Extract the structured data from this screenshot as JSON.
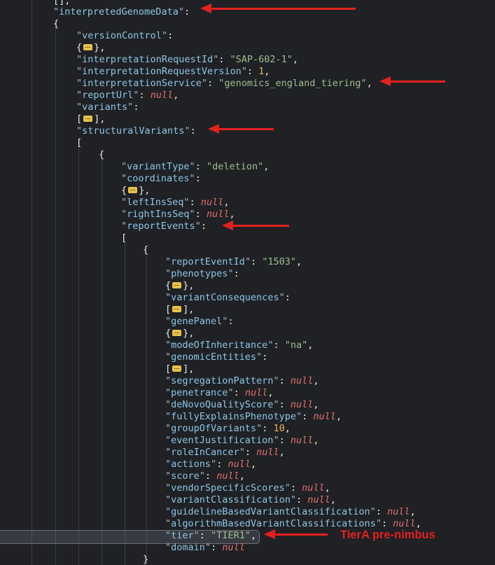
{
  "punct": {
    "q": "\"",
    "colon": ": ",
    "comma": ",",
    "open_brace": "{",
    "close_brace": "}",
    "open_bracket": "[",
    "close_bracket": "]",
    "top_fragment": "[],"
  },
  "json": {
    "interpreted_genome_data_key": "interpretedGenomeData",
    "version_control_key": "versionControl",
    "interpretation_request_id_key": "interpretationRequestId",
    "interpretation_request_id_value": "\"SAP-602-1\"",
    "interpretation_request_version_key": "interpretationRequestVersion",
    "interpretation_request_version_value": "1",
    "interpretation_service_key": "interpretationService",
    "interpretation_service_value": "\"genomics_england_tiering\"",
    "report_url_key": "reportUrl",
    "null_value": "null",
    "variants_key": "variants",
    "structural_variants_key": "structuralVariants",
    "variant_type_key": "variantType",
    "variant_type_value": "\"deletion\"",
    "coordinates_key": "coordinates",
    "left_ins_seq_key": "leftInsSeq",
    "right_ins_seq_key": "rightInsSeq",
    "report_events_key": "reportEvents",
    "report_event_id_key": "reportEventId",
    "report_event_id_value": "\"1503\"",
    "phenotypes_key": "phenotypes",
    "variant_consequences_key": "variantConsequences",
    "gene_panel_key": "genePanel",
    "mode_of_inheritance_key": "modeOfInheritance",
    "mode_of_inheritance_value": "\"na\"",
    "genomic_entities_key": "genomicEntities",
    "segregation_pattern_key": "segregationPattern",
    "penetrance_key": "penetrance",
    "de_novo_quality_score_key": "deNovoQualityScore",
    "fully_explains_phenotype_key": "fullyExplainsPhenotype",
    "group_of_variants_key": "groupOfVariants",
    "group_of_variants_value": "10",
    "event_justification_key": "eventJustification",
    "role_in_cancer_key": "roleInCancer",
    "actions_key": "actions",
    "score_key": "score",
    "vendor_specific_scores_key": "vendorSpecificScores",
    "variant_classification_key": "variantClassification",
    "guideline_based_key": "guidelineBasedVariantClassification",
    "algorithm_based_key": "algorithmBasedVariantClassifications",
    "tier_key": "tier",
    "tier_value": "\"TIER1\"",
    "domain_key": "domain"
  },
  "annotation": {
    "label": "TierA pre-nimbus"
  },
  "colors": {
    "background": "#1f2125",
    "key": "#8fc6e6",
    "string": "#9fbf8f",
    "number": "#e6b15c",
    "null": "#e5706e",
    "fold_badge": "#e7c447",
    "arrow": "#e5201f"
  },
  "icons": {
    "fold": "collapsed-ellipsis-icon",
    "arrow": "red-arrow-left-icon"
  }
}
